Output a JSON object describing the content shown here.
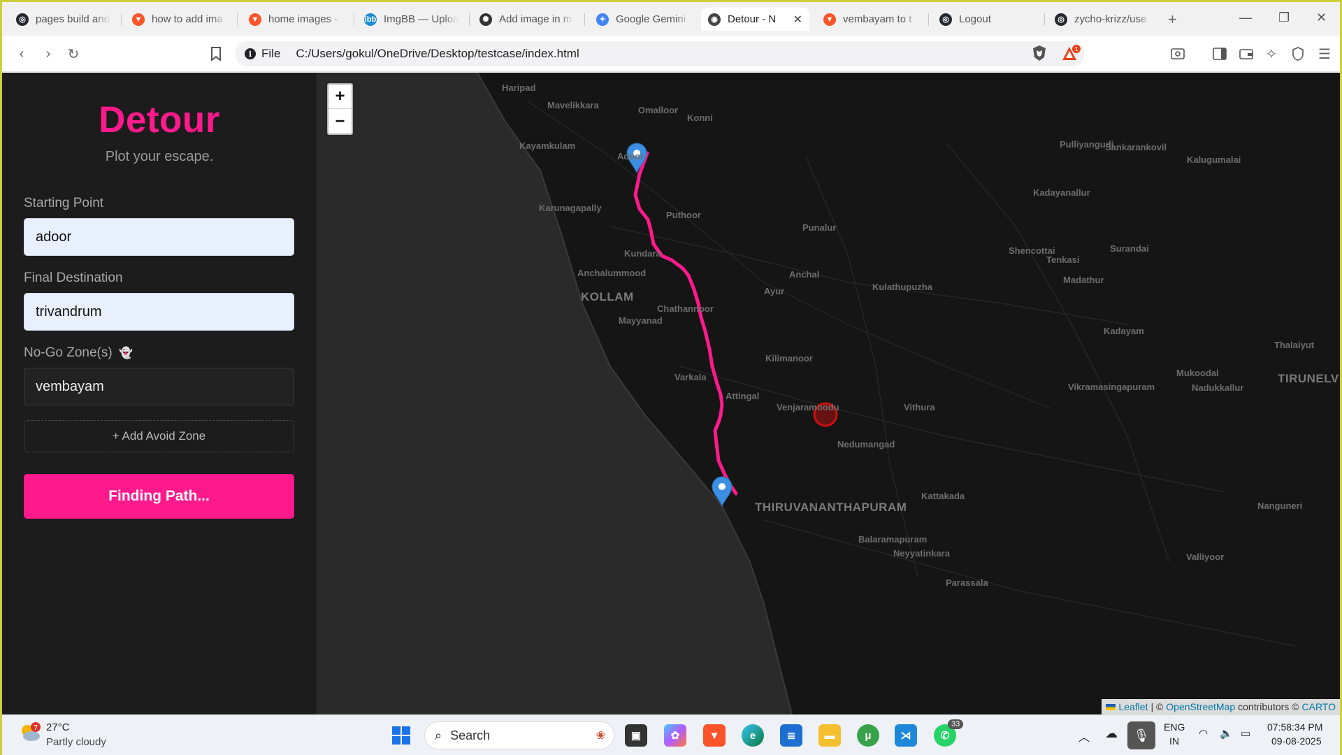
{
  "tabs": [
    {
      "title": "pages build and",
      "color": "#24292f",
      "glyph": "◎",
      "icon": "github-icon"
    },
    {
      "title": "how to add ima",
      "color": "#fb542b",
      "glyph": "▼",
      "icon": "brave-icon"
    },
    {
      "title": "home images -",
      "color": "#fb542b",
      "glyph": "▼",
      "icon": "brave-icon"
    },
    {
      "title": "ImgBB — Uploa",
      "color": "#1d8bd6",
      "glyph": "ibb",
      "icon": "imgbb-icon"
    },
    {
      "title": "Add image in m",
      "color": "#333333",
      "glyph": "✺",
      "icon": "chatgpt-icon"
    },
    {
      "title": "Google Gemini",
      "color": "#4285f4",
      "glyph": "✦",
      "icon": "gemini-icon"
    },
    {
      "title": "Detour - N",
      "color": "#444444",
      "glyph": "◉",
      "icon": "globe-icon",
      "active": true
    },
    {
      "title": "vembayam to t",
      "color": "#fb542b",
      "glyph": "▼",
      "icon": "brave-icon"
    },
    {
      "title": "Logout",
      "color": "#24292f",
      "glyph": "◎",
      "icon": "github-icon"
    },
    {
      "title": "zycho-krizz/use",
      "color": "#24292f",
      "glyph": "◎",
      "icon": "github-icon"
    }
  ],
  "toolbar": {
    "file_label": "File",
    "url": "C:/Users/gokul/OneDrive/Desktop/testcase/index.html",
    "notification_count": "1"
  },
  "app": {
    "brand": "Detour",
    "tagline": "Plot your escape.",
    "start_label": "Starting Point",
    "start_value": "adoor",
    "dest_label": "Final Destination",
    "dest_value": "trivandrum",
    "nogo_label": "No-Go Zone(s)",
    "nogo_emoji": "👻",
    "nogo_value": "vembayam",
    "add_zone_label": "+ Add Avoid Zone",
    "find_button_label": "Finding Path..."
  },
  "map": {
    "zoom_in": "+",
    "zoom_out": "−",
    "route_color": "#ff1a8c",
    "marker_color": "#3b8ee0",
    "nogo_color": "#cc1111",
    "attribution": {
      "leaflet": "Leaflet",
      "sep1": "| ©",
      "osm": "OpenStreetMap",
      "contrib": "contributors ©",
      "carto": "CARTO"
    },
    "places": [
      {
        "name": "Haripad",
        "kind": "town"
      },
      {
        "name": "Mavelikkara",
        "kind": "town"
      },
      {
        "name": "Omalloor",
        "kind": "town"
      },
      {
        "name": "Konni",
        "kind": "town"
      },
      {
        "name": "Kayamkulam",
        "kind": "town"
      },
      {
        "name": "Adoor",
        "kind": "town"
      },
      {
        "name": "Pulliyangudi",
        "kind": "town"
      },
      {
        "name": "Sankarankovil",
        "kind": "town"
      },
      {
        "name": "Kalugumalai",
        "kind": "town"
      },
      {
        "name": "Karunagapally",
        "kind": "town"
      },
      {
        "name": "Puthoor",
        "kind": "town"
      },
      {
        "name": "Kadayanallur",
        "kind": "town"
      },
      {
        "name": "Punalur",
        "kind": "town"
      },
      {
        "name": "Kundara",
        "kind": "town"
      },
      {
        "name": "Shencottai",
        "kind": "town"
      },
      {
        "name": "Tenkasi",
        "kind": "town"
      },
      {
        "name": "Surandai",
        "kind": "town"
      },
      {
        "name": "Anchalummood",
        "kind": "town"
      },
      {
        "name": "Anchal",
        "kind": "town"
      },
      {
        "name": "Madathur",
        "kind": "town"
      },
      {
        "name": "KOLLAM",
        "kind": "city"
      },
      {
        "name": "Kulathupuzha",
        "kind": "town"
      },
      {
        "name": "Ayur",
        "kind": "town"
      },
      {
        "name": "Chathannoor",
        "kind": "town"
      },
      {
        "name": "Mayyanad",
        "kind": "town"
      },
      {
        "name": "Kadayam",
        "kind": "town"
      },
      {
        "name": "Thalaiyut",
        "kind": "town"
      },
      {
        "name": "Kilimanoor",
        "kind": "town"
      },
      {
        "name": "Mukoodal",
        "kind": "town"
      },
      {
        "name": "TIRUNELV",
        "kind": "city"
      },
      {
        "name": "Varkala",
        "kind": "town"
      },
      {
        "name": "Vikramasingapuram",
        "kind": "town"
      },
      {
        "name": "Nadukkallur",
        "kind": "town"
      },
      {
        "name": "Attingal",
        "kind": "town"
      },
      {
        "name": "Venjaramoodu",
        "kind": "town"
      },
      {
        "name": "Vithura",
        "kind": "town"
      },
      {
        "name": "Nedumangad",
        "kind": "town"
      },
      {
        "name": "Kattakada",
        "kind": "town"
      },
      {
        "name": "THIRUVANANTHAPURAM",
        "kind": "city"
      },
      {
        "name": "Nanguneri",
        "kind": "town"
      },
      {
        "name": "Balaramapuram",
        "kind": "town"
      },
      {
        "name": "Neyyatinkara",
        "kind": "town"
      },
      {
        "name": "Valliyoor",
        "kind": "town"
      },
      {
        "name": "Parassala",
        "kind": "town"
      }
    ]
  },
  "taskbar": {
    "weather_temp": "27°C",
    "weather_desc": "Partly cloudy",
    "weather_badge": "7",
    "search_label": "Search",
    "whatsapp_badge": "33",
    "lang_top": "ENG",
    "lang_bottom": "IN",
    "time": "07:58:34 PM",
    "date": "09-08-2025"
  }
}
